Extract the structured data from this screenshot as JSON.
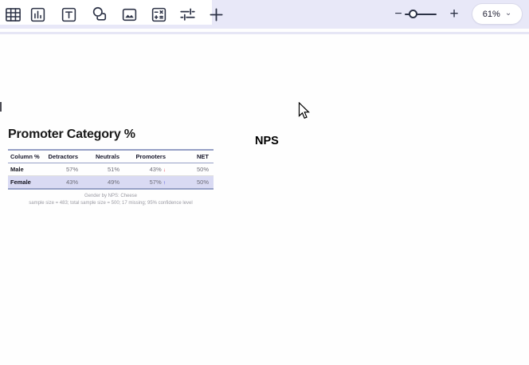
{
  "toolbar": {
    "tools": [
      {
        "name": "table"
      },
      {
        "name": "chart"
      },
      {
        "name": "text-box"
      },
      {
        "name": "shapes"
      },
      {
        "name": "image"
      },
      {
        "name": "calculation"
      },
      {
        "name": "controls"
      },
      {
        "name": "add-more"
      }
    ],
    "zoom": {
      "minus_label": "−",
      "plus_label": "+",
      "level": "61%",
      "chevron": "⌄"
    }
  },
  "canvas": {
    "widget": {
      "title": "Promoter Category %",
      "table": {
        "headers": [
          "Column %",
          "Detractors",
          "Neutrals",
          "Promoters",
          "NET"
        ],
        "rows": [
          {
            "label": "Male",
            "cells": [
              {
                "text": "57%"
              },
              {
                "text": "51%"
              },
              {
                "text": "43%",
                "arrow": "↓",
                "significance": "down"
              },
              {
                "text": "50%"
              }
            ]
          },
          {
            "label": "Female",
            "highlighted": true,
            "cells": [
              {
                "text": "43%"
              },
              {
                "text": "49%"
              },
              {
                "text": "57%",
                "arrow": "↑",
                "significance": "up"
              },
              {
                "text": "50%"
              }
            ]
          }
        ]
      },
      "footnote_line1": "Gender by NPS: Cheese",
      "footnote_line2": "sample size = 483; total sample size = 500; 17 missing; 95% confidence level"
    },
    "text_label": "NPS"
  },
  "colors": {
    "toolbar_bg": "#e8e8f8",
    "icon": "#2c3246",
    "table_border": "#96a0c6",
    "row_highlight": "#d9daf3",
    "sig_down": "#e02b3f",
    "sig_up": "#2b2bd6"
  }
}
